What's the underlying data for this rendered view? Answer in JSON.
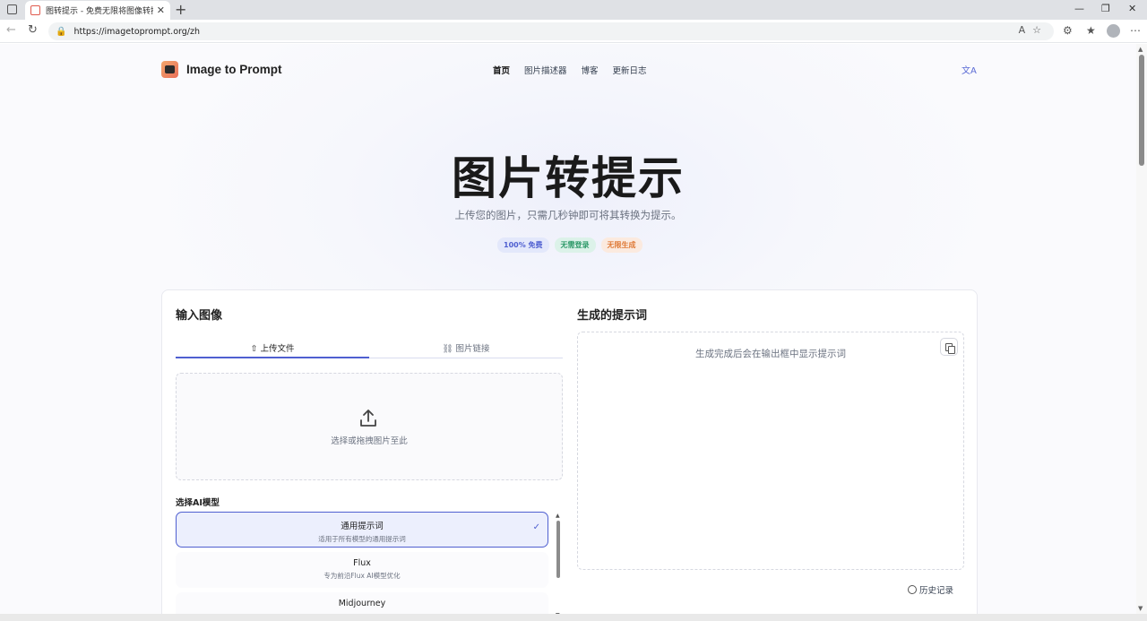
{
  "browser": {
    "tab_title": "图转提示 - 免费无限将图像转换为",
    "tab_close": "✕",
    "url": "https://imagetoprompt.org/zh"
  },
  "header": {
    "logo_text": "Image to Prompt",
    "nav": [
      "首页",
      "图片描述器",
      "博客",
      "更新日志"
    ],
    "lang_icon": "translate-icon"
  },
  "hero": {
    "title": "图片转提示",
    "subtitle": "上传您的图片，只需几秒钟即可将其转换为提示。",
    "badges": [
      "100% 免费",
      "无需登录",
      "无限生成"
    ]
  },
  "input": {
    "title": "输入图像",
    "tabs": [
      "上传文件",
      "图片链接"
    ],
    "dropzone_text": "选择或拖拽图片至此",
    "model_label": "选择AI模型",
    "models": [
      {
        "name": "通用提示词",
        "desc": "适用于所有模型的通用提示词",
        "selected": true
      },
      {
        "name": "Flux",
        "desc": "专为前沿Flux AI模型优化",
        "selected": false
      },
      {
        "name": "Midjourney",
        "desc": "",
        "selected": false
      }
    ]
  },
  "output": {
    "title": "生成的提示词",
    "placeholder": "生成完成后会在输出框中显示提示词",
    "history_label": "历史记录"
  },
  "colors": {
    "accent": "#4f5fd0",
    "badge_green": "#2f9a6a",
    "badge_orange": "#df7a37"
  }
}
